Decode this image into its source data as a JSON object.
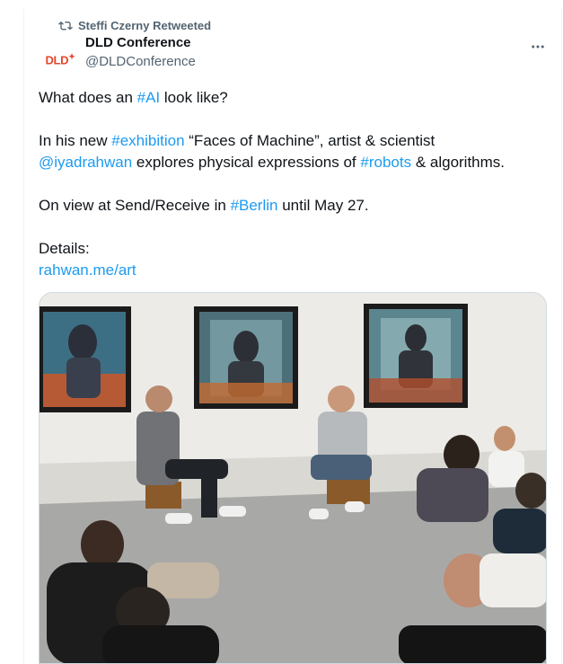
{
  "retweet": {
    "label": "Steffi Czerny Retweeted"
  },
  "author": {
    "avatar_text": "DLD",
    "name": "DLD Conference",
    "handle": "@DLDConference"
  },
  "tweet": {
    "line1": {
      "pre": "What does an ",
      "tag": "#AI",
      "post": " look like?"
    },
    "line2": {
      "pre": "In his new ",
      "tag1": "#exhibition",
      "mid1": " “Faces of Machine”, artist & scientist",
      "mention": "@iyadrahwan",
      "mid2": " explores physical expressions of ",
      "tag2": "#robots",
      "post": " & algorithms."
    },
    "line3": {
      "pre": "On view at Send/Receive in ",
      "tag": "#Berlin",
      "post": " until May 27."
    },
    "details_label": "Details:",
    "details_link": "rahwan.me/art"
  },
  "icons": {
    "retweet": "retweet-icon",
    "more": "more-options-icon"
  },
  "colors": {
    "link": "#1d9bf0",
    "secondary": "#536471",
    "text": "#0f1419",
    "brand": "#e4472b"
  }
}
